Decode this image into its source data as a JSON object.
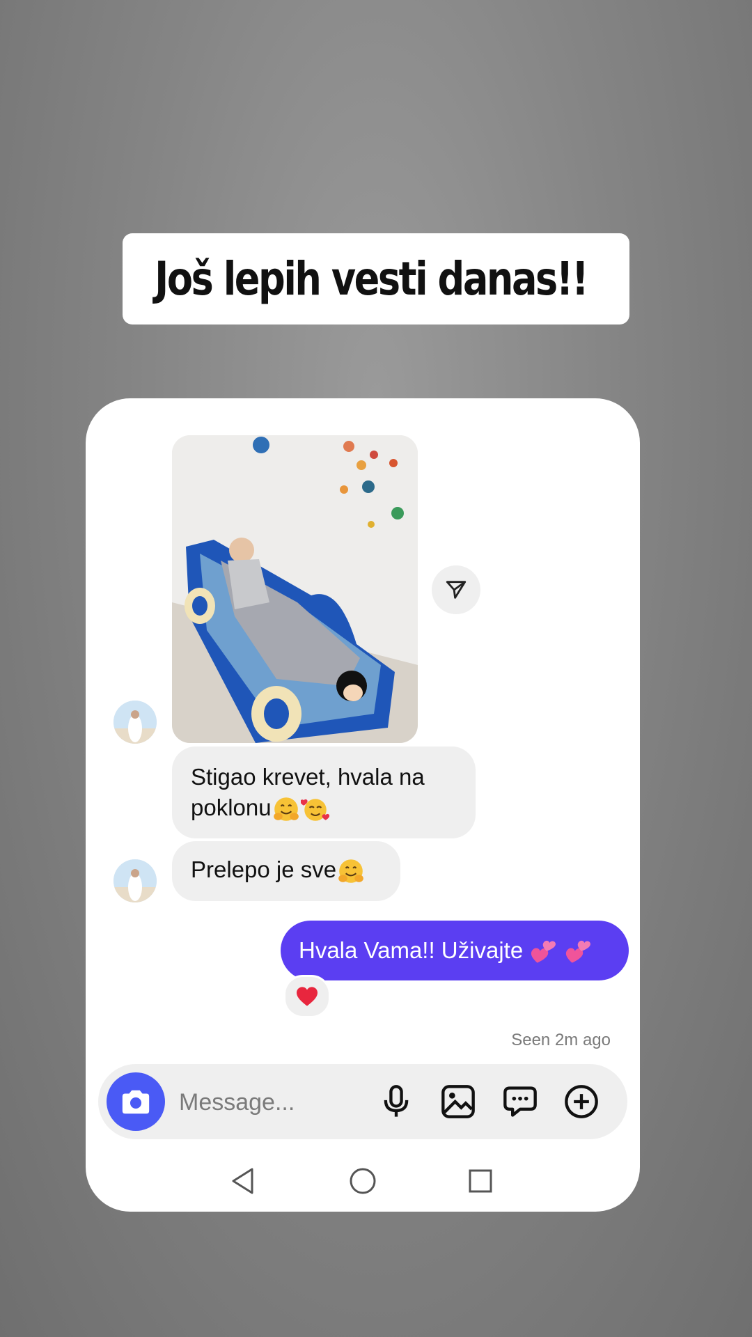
{
  "story_caption": "Još lepih vesti danas!!",
  "chat": {
    "messages_in": [
      {
        "text_line1": "Stigao krevet, hvala na",
        "text_line2": "poklonu"
      },
      {
        "text": "Prelepo je sve"
      }
    ],
    "message_out": {
      "text": "Hvala Vama!! Uživajte"
    },
    "reaction": "heart",
    "seen_status": "Seen 2m ago"
  },
  "composer": {
    "placeholder": "Message..."
  },
  "icons": [
    "two-hearts-icon",
    "paper-plane-icon",
    "camera-icon",
    "microphone-icon",
    "gallery-icon",
    "chat-bubble-icon",
    "plus-circle-icon",
    "back-icon",
    "home-icon",
    "recents-icon",
    "hugging-face-icon",
    "smiling-hearts-icon",
    "red-heart-icon"
  ],
  "colors": {
    "sent_bubble": "#5b3ef2",
    "camera_button": "#4a5af5",
    "received_bubble": "#efefef"
  }
}
